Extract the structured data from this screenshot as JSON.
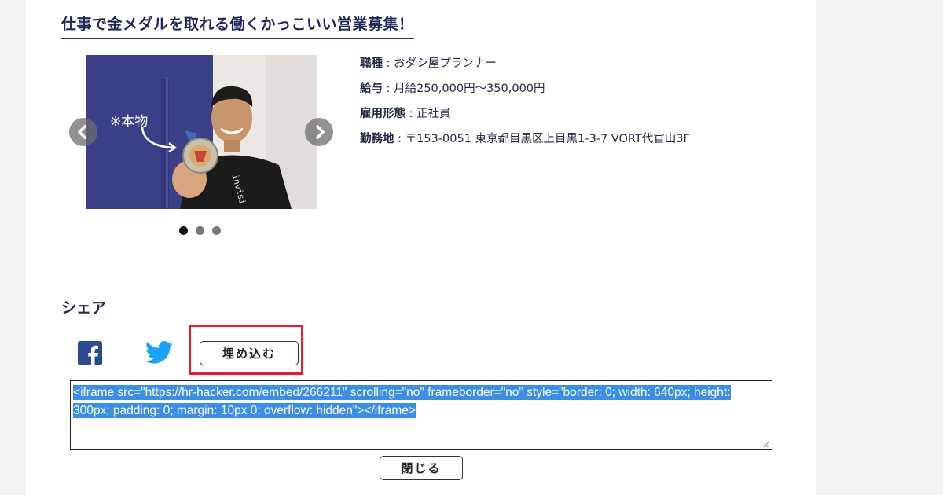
{
  "heading": "仕事で金メダルを取れる働くかっこいい営業募集！",
  "carousel": {
    "photo_caption": "※本物",
    "shirt_text": "invisi",
    "slides_count": 3,
    "active_index": 0,
    "prev_icon": "chevron-left-icon",
    "next_icon": "chevron-right-icon"
  },
  "job": {
    "rows": [
      {
        "label": "職種",
        "sep": " : ",
        "value": "おダシ屋プランナー"
      },
      {
        "label": "給与",
        "sep": " : ",
        "value": "月給250,000円〜350,000円"
      },
      {
        "label": "雇用形態",
        "sep": " : ",
        "value": "正社員"
      },
      {
        "label": "勤務地",
        "sep": " : ",
        "value": "〒153-0051 東京都目黒区上目黒1-3-7 VORT代官山3F"
      }
    ]
  },
  "share": {
    "title": "シェア",
    "facebook_icon": "facebook-icon",
    "twitter_icon": "twitter-icon",
    "embed_label": "埋め込む",
    "embed_code": "<iframe src=\"https://hr-hacker.com/embed/266211\" scrolling=\"no\" frameborder=\"no\" style=\"border: 0; width: 640px; height: 300px; padding: 0; margin: 10px 0; overflow: hidden\"></iframe>",
    "close_label": "閉じる"
  },
  "colors": {
    "accent_navy": "#1f2a5a",
    "highlight_red": "#e0202c",
    "selection_blue": "#3a8ee6",
    "facebook_blue": "#2b4a8f",
    "twitter_blue": "#1da1f2"
  }
}
